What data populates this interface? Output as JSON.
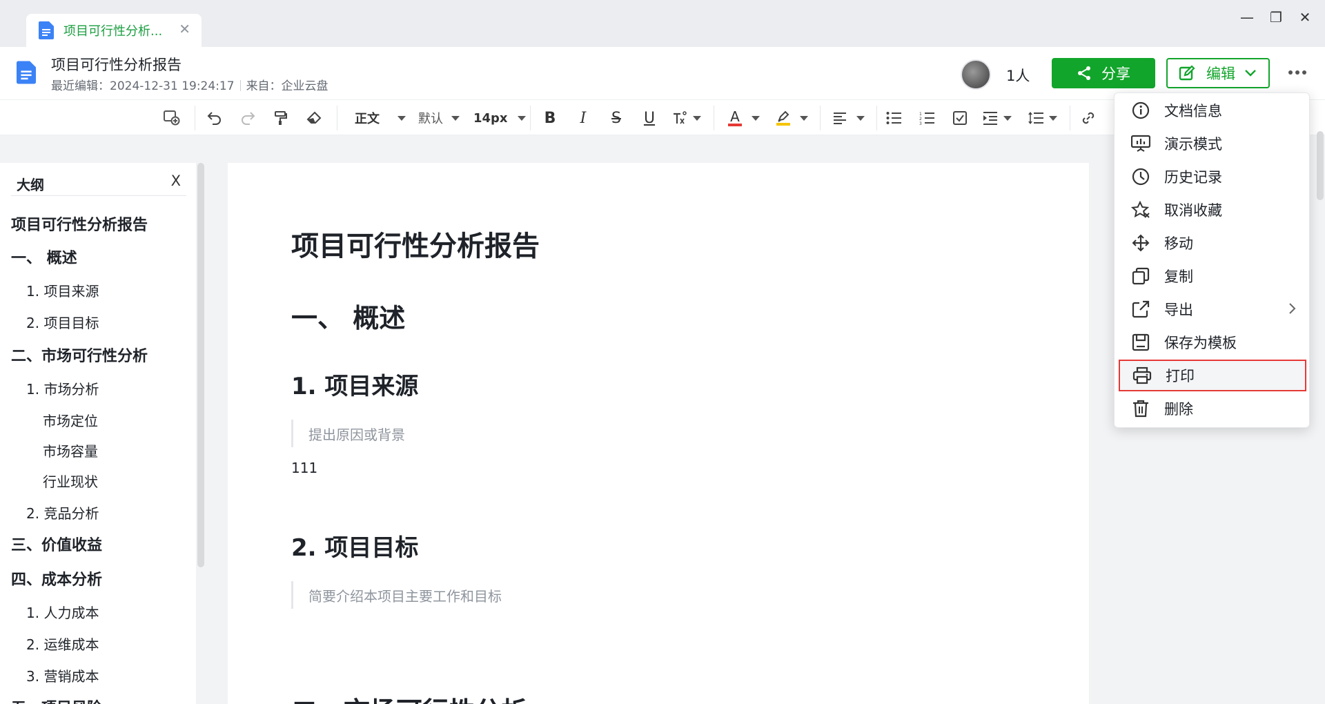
{
  "tab": {
    "title": "项目可行性分析...",
    "close": "✕"
  },
  "window": {
    "minimize": "—",
    "restore": "❐",
    "close": "✕"
  },
  "header": {
    "title": "项目可行性分析报告",
    "last_edited": "最近编辑：2024-12-31 19:24:17",
    "source": "来自：企业云盘",
    "person_count": "1人",
    "share_label": "分享",
    "edit_label": "编辑"
  },
  "toolbar": {
    "paragraph_style": "正文",
    "font": "默认",
    "font_size": "14px",
    "bold": "B",
    "italic": "I",
    "strike": "S",
    "underline": "U",
    "font_color": "A"
  },
  "outline": {
    "title": "大纲",
    "close": "X",
    "items": [
      {
        "level": 1,
        "text": "项目可行性分析报告"
      },
      {
        "level": 1,
        "text": "一、 概述"
      },
      {
        "level": 2,
        "text": "1. 项目来源"
      },
      {
        "level": 2,
        "text": "2. 项目目标"
      },
      {
        "level": 1,
        "text": "二、市场可行性分析"
      },
      {
        "level": 2,
        "text": "1. 市场分析"
      },
      {
        "level": 3,
        "text": "市场定位"
      },
      {
        "level": 3,
        "text": "市场容量"
      },
      {
        "level": 3,
        "text": "行业现状"
      },
      {
        "level": 2,
        "text": "2. 竞品分析"
      },
      {
        "level": 1,
        "text": "三、价值收益"
      },
      {
        "level": 1,
        "text": "四、成本分析"
      },
      {
        "level": 2,
        "text": "1. 人力成本"
      },
      {
        "level": 2,
        "text": "2. 运维成本"
      },
      {
        "level": 2,
        "text": "3. 营销成本"
      },
      {
        "level": 1,
        "text": "五、项目风险"
      }
    ]
  },
  "document": {
    "title": "项目可行性分析报告",
    "section1": "一、 概述",
    "sub1": "1. 项目来源",
    "quote1": "提出原因或背景",
    "para1": "111",
    "sub2": "2. 项目目标",
    "quote2": "简要介绍本项目主要工作和目标",
    "section2": "二、市场可行性分析"
  },
  "menu": {
    "items": [
      {
        "label": "文档信息",
        "icon": "info-icon"
      },
      {
        "label": "演示模式",
        "icon": "presentation-icon"
      },
      {
        "label": "历史记录",
        "icon": "clock-icon"
      },
      {
        "label": "取消收藏",
        "icon": "star-remove-icon"
      },
      {
        "label": "移动",
        "icon": "move-icon"
      },
      {
        "label": "复制",
        "icon": "copy-icon"
      },
      {
        "label": "导出",
        "icon": "export-icon"
      },
      {
        "label": "保存为模板",
        "icon": "save-icon"
      },
      {
        "label": "打印",
        "icon": "printer-icon"
      },
      {
        "label": "删除",
        "icon": "trash-icon"
      }
    ],
    "highlighted": "打印"
  },
  "colors": {
    "brand_green": "#12a52b",
    "highlight_red": "#e53935",
    "font_color_bar": "#e53935",
    "highlight_color_bar": "#f5c400"
  }
}
